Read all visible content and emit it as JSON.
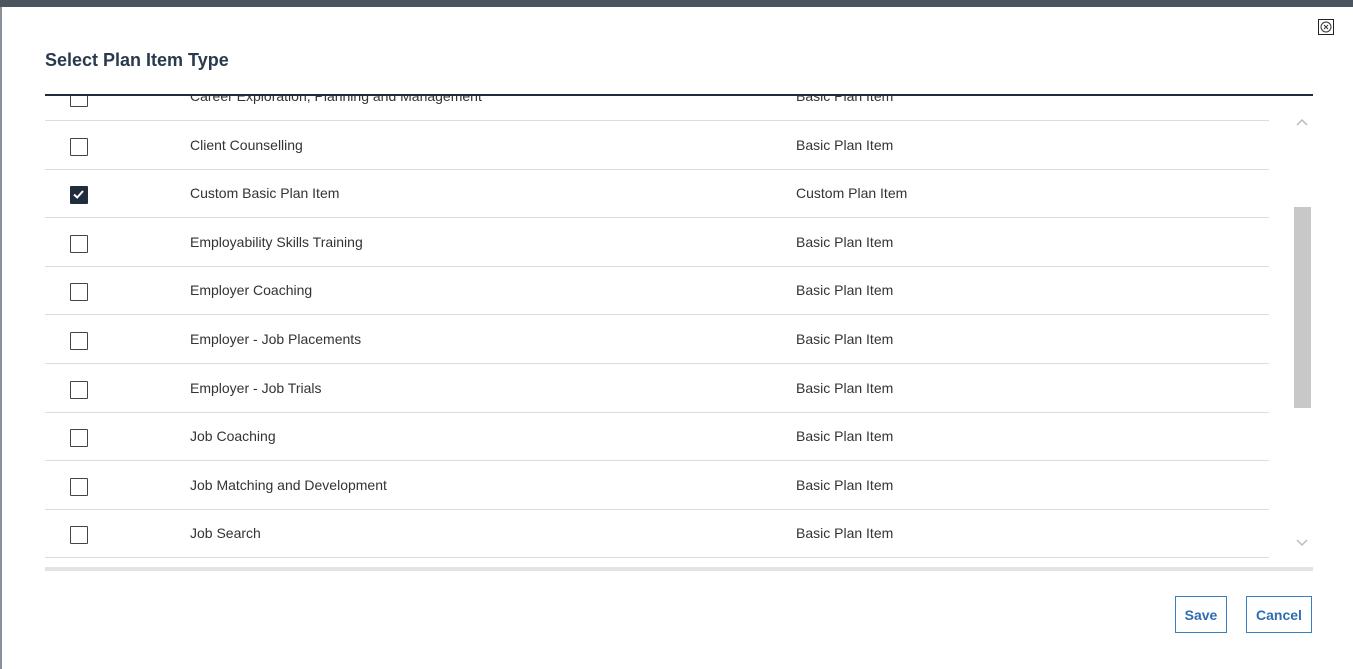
{
  "dialog": {
    "title": "Select Plan Item Type",
    "close_icon": "close-icon"
  },
  "items": [
    {
      "name": "Career Exploration, Planning and Management",
      "type": "Basic Plan Item",
      "checked": false
    },
    {
      "name": "Client Counselling",
      "type": "Basic Plan Item",
      "checked": false
    },
    {
      "name": "Custom Basic Plan Item",
      "type": "Custom Plan Item",
      "checked": true
    },
    {
      "name": "Employability Skills Training",
      "type": "Basic Plan Item",
      "checked": false
    },
    {
      "name": "Employer Coaching",
      "type": "Basic Plan Item",
      "checked": false
    },
    {
      "name": "Employer - Job Placements",
      "type": "Basic Plan Item",
      "checked": false
    },
    {
      "name": "Employer - Job Trials",
      "type": "Basic Plan Item",
      "checked": false
    },
    {
      "name": "Job Coaching",
      "type": "Basic Plan Item",
      "checked": false
    },
    {
      "name": "Job Matching and Development",
      "type": "Basic Plan Item",
      "checked": false
    },
    {
      "name": "Job Search",
      "type": "Basic Plan Item",
      "checked": false
    }
  ],
  "footer": {
    "save_label": "Save",
    "cancel_label": "Cancel"
  },
  "colors": {
    "accent": "#3a7fc1",
    "title": "#2a3a4d",
    "checked_fill": "#1f2d3d"
  }
}
